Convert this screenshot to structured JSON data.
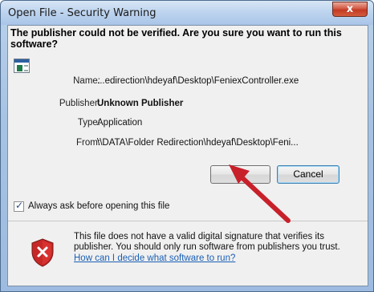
{
  "window": {
    "title": "Open File - Security Warning",
    "close_glyph": "x"
  },
  "headline": "The publisher could not be verified.  Are you sure you want to run this software?",
  "fields": {
    "name_label": "Name:",
    "name_value": "...edirection\\hdeyaf\\Desktop\\FeniexController.exe",
    "publisher_label": "Publisher:",
    "publisher_value": "Unknown Publisher",
    "type_label": "Type:",
    "type_value": "Application",
    "from_label": "From:",
    "from_value": "\\\\DATA\\Folder Redirection\\hdeyaf\\Desktop\\Feni..."
  },
  "buttons": {
    "run_label": "R",
    "cancel_label": "Cancel"
  },
  "checkbox": {
    "label": "Always ask before opening this file",
    "checked": true
  },
  "warning": {
    "text": "This file does not have a valid digital signature that verifies its publisher.  You should only run software from publishers you trust.",
    "link": "How can I decide what software to run?"
  },
  "icons": {
    "app": "application-icon",
    "shield": "security-shield-icon",
    "arrow": "red-arrow-annotation"
  },
  "colors": {
    "link": "#1a5fb4",
    "arrow": "#c8202a",
    "shield": "#c62828"
  }
}
